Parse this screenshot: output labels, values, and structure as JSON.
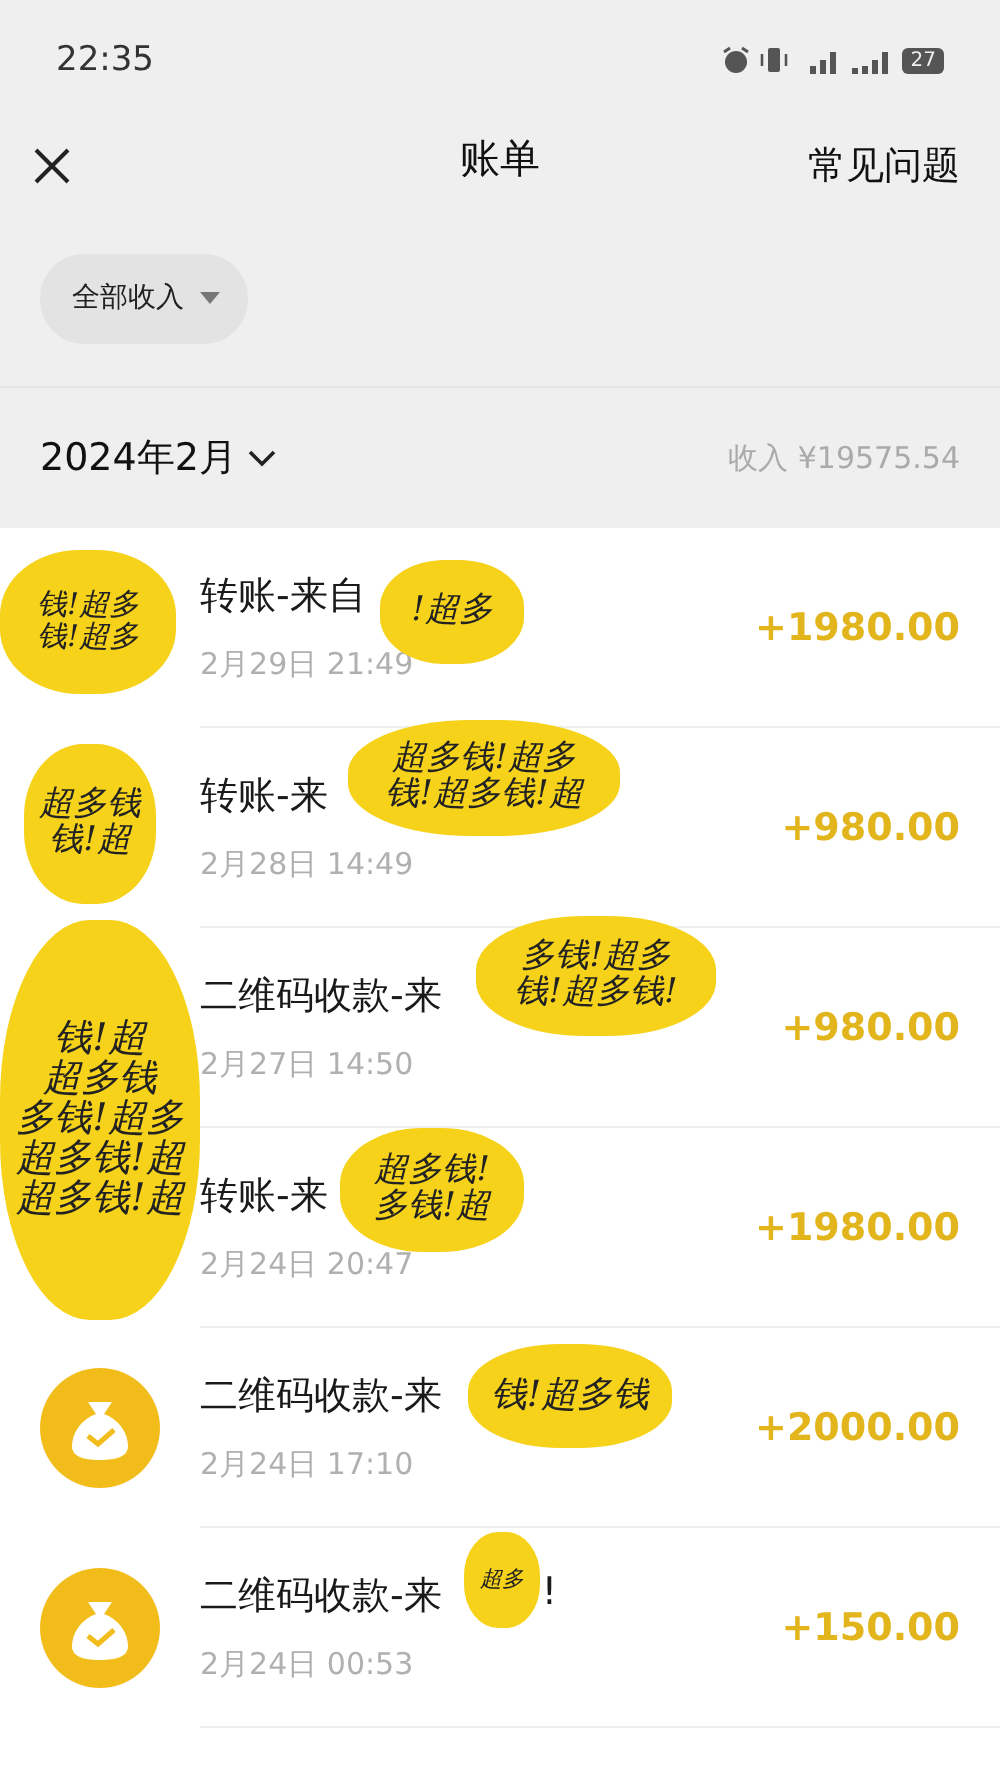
{
  "status_bar": {
    "time": "22:35",
    "battery": "27"
  },
  "header": {
    "title": "账单",
    "help": "常见问题"
  },
  "filter": {
    "label": "全部收入"
  },
  "month": {
    "label": "2024年2月",
    "income": "收入 ¥19575.54"
  },
  "rows": [
    {
      "title": "转账-来自",
      "date": "2月29日 21:49",
      "amount": "+1980.00",
      "kind": "covered"
    },
    {
      "title": "转账-来",
      "date": "2月28日 14:49",
      "amount": "+980.00",
      "kind": "covered"
    },
    {
      "title": "二维码收款-来",
      "date": "2月27日 14:50",
      "amount": "+980.00",
      "kind": "covered"
    },
    {
      "title": "转账-来",
      "date": "2月24日 20:47",
      "amount": "+1980.00",
      "kind": "covered"
    },
    {
      "title": "二维码收款-来",
      "date": "2月24日 17:10",
      "amount": "+2000.00",
      "kind": "iconed"
    },
    {
      "title": "二维码收款-来",
      "title_end": "!",
      "date": "2月24日 00:53",
      "amount": "+150.00",
      "kind": "iconed"
    }
  ],
  "scribbles": [
    {
      "lines": [
        "钱!超多",
        "钱!超多"
      ]
    },
    {
      "lines": [
        "!超多"
      ]
    },
    {
      "lines": [
        "超多钱!超多",
        "钱!超多钱!超"
      ]
    },
    {
      "lines": [
        "超多钱",
        "钱!超"
      ]
    },
    {
      "lines": [
        "多钱!超多",
        "钱!超多钱!"
      ]
    },
    {
      "lines": [
        "钱!超",
        "超多钱",
        "多钱!超多",
        "超多钱!超",
        "超多钱!超"
      ]
    },
    {
      "lines": [
        "超多钱!",
        "多钱!超"
      ]
    },
    {
      "lines": [
        "钱!超多钱"
      ]
    },
    {
      "lines": [
        "超多"
      ]
    }
  ]
}
